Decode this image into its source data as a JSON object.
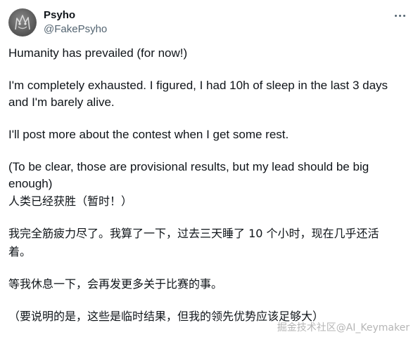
{
  "author": {
    "display_name": "Psyho",
    "handle": "@FakePsyho",
    "avatar": "sketch-avatar-icon"
  },
  "menu": {
    "icon": "more-options-icon"
  },
  "tweet": {
    "en_paragraphs": [
      "Humanity has prevailed (for now!)",
      "I'm completely exhausted. I figured, I had 10h of sleep in the last 3 days\nand I'm barely alive.",
      "I'll post more about the contest when I get some rest.",
      "(To be clear, those are provisional results, but my lead should be big\nenough)"
    ],
    "zh_paragraphs": [
      "人类已经获胜（暂时！）",
      "我完全筋疲力尽了。我算了一下，过去三天睡了 10 个小时，现在几乎还活\n着。",
      "等我休息一下，会再发更多关于比赛的事。",
      "（要说明的是，这些是临时结果，但我的领先优势应该足够大）"
    ]
  },
  "watermark": {
    "text": "掘金技术社区@AI_Keymaker"
  }
}
